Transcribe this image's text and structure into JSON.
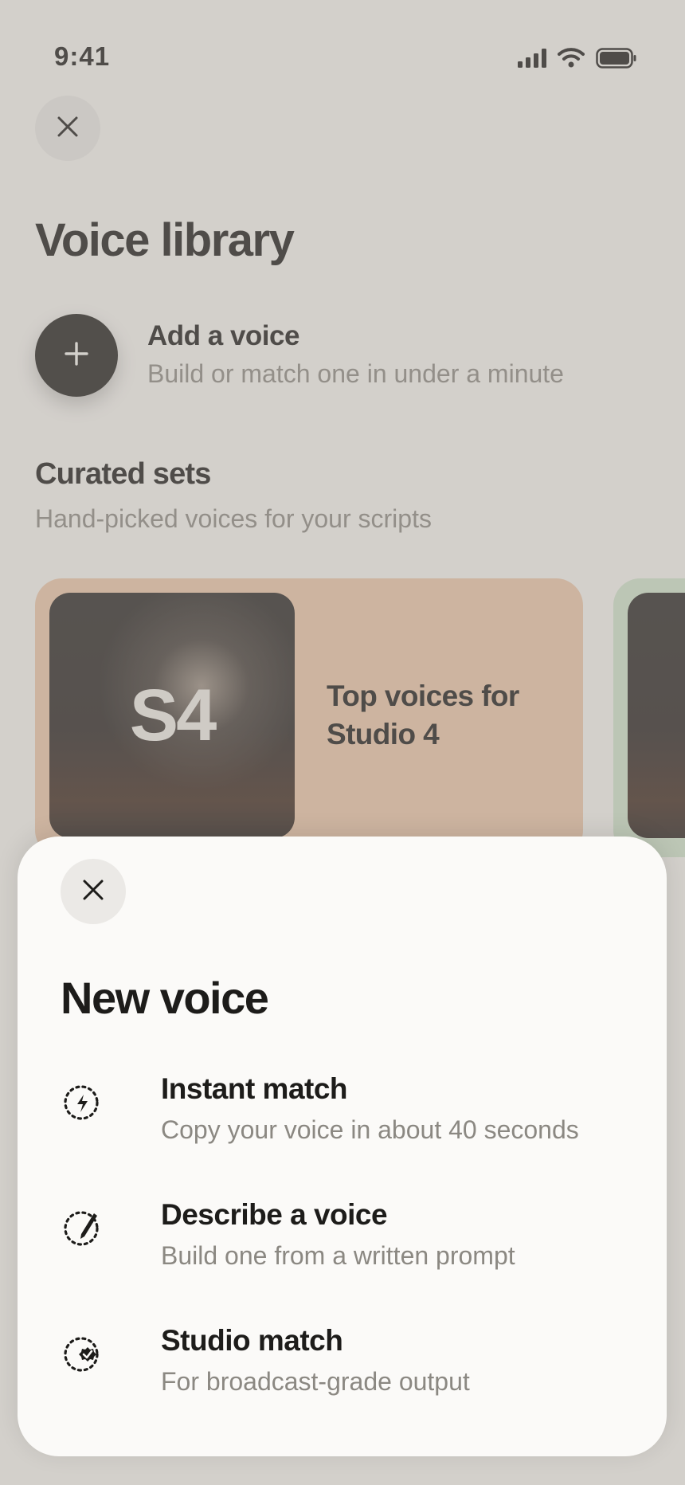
{
  "status_bar": {
    "time": "9:41",
    "icons": [
      "signal-icon",
      "wifi-icon",
      "battery-icon"
    ]
  },
  "library": {
    "title": "Voice library",
    "add_voice": {
      "title": "Add a voice",
      "subtitle": "Build or match one in under a minute"
    },
    "curated": {
      "title": "Curated sets",
      "subtitle": "Hand-picked voices for your scripts",
      "cards": [
        {
          "thumb_label": "S4",
          "title": "Top voices for Studio 4",
          "color": "#e9c4a6"
        },
        {
          "thumb_label": "",
          "title": "",
          "color": "#cde0c8"
        }
      ]
    }
  },
  "sheet": {
    "title": "New voice",
    "options": [
      {
        "title": "Instant match",
        "subtitle": "Copy your voice in about 40 seconds",
        "icon": "instant-match-icon"
      },
      {
        "title": "Describe a voice",
        "subtitle": "Build one from a written prompt",
        "icon": "describe-voice-icon"
      },
      {
        "title": "Studio match",
        "subtitle": "For broadcast-grade output",
        "icon": "studio-match-icon"
      }
    ]
  },
  "colors": {
    "dark": "#23211e",
    "muted_text": "#8b8882",
    "sheet_bg": "#fbfaf8"
  }
}
